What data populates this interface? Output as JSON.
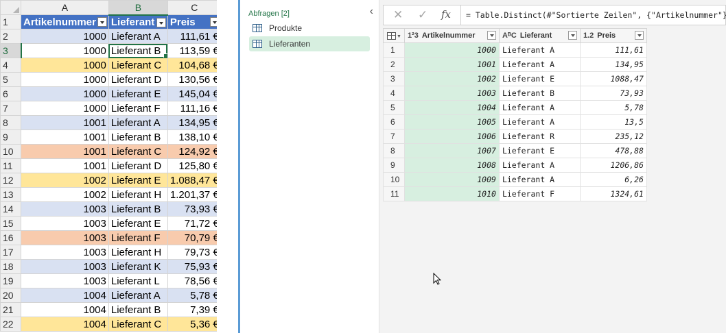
{
  "excel": {
    "col_headers": [
      "A",
      "B",
      "C"
    ],
    "table_headers": [
      "Artikelnummer",
      "Lieferant",
      "Preis"
    ],
    "rows": [
      {
        "rownum": "2",
        "art": "1000",
        "lief": "Lieferant A",
        "preis": "111,61 €",
        "color": "blue"
      },
      {
        "rownum": "3",
        "art": "1000",
        "lief": "Lieferant B",
        "preis": "113,59 €",
        "color": "white"
      },
      {
        "rownum": "4",
        "art": "1000",
        "lief": "Lieferant C",
        "preis": "104,68 €",
        "color": "yellow"
      },
      {
        "rownum": "5",
        "art": "1000",
        "lief": "Lieferant D",
        "preis": "130,56 €",
        "color": "white"
      },
      {
        "rownum": "6",
        "art": "1000",
        "lief": "Lieferant E",
        "preis": "145,04 €",
        "color": "blue"
      },
      {
        "rownum": "7",
        "art": "1000",
        "lief": "Lieferant F",
        "preis": "111,16 €",
        "color": "white"
      },
      {
        "rownum": "8",
        "art": "1001",
        "lief": "Lieferant A",
        "preis": "134,95 €",
        "color": "blue"
      },
      {
        "rownum": "9",
        "art": "1001",
        "lief": "Lieferant B",
        "preis": "138,10 €",
        "color": "white"
      },
      {
        "rownum": "10",
        "art": "1001",
        "lief": "Lieferant C",
        "preis": "124,92 €",
        "color": "orange"
      },
      {
        "rownum": "11",
        "art": "1001",
        "lief": "Lieferant D",
        "preis": "125,80 €",
        "color": "white"
      },
      {
        "rownum": "12",
        "art": "1002",
        "lief": "Lieferant E",
        "preis": "1.088,47 €",
        "color": "yellow"
      },
      {
        "rownum": "13",
        "art": "1002",
        "lief": "Lieferant H",
        "preis": "1.201,37 €",
        "color": "white"
      },
      {
        "rownum": "14",
        "art": "1003",
        "lief": "Lieferant B",
        "preis": "73,93 €",
        "color": "blue"
      },
      {
        "rownum": "15",
        "art": "1003",
        "lief": "Lieferant E",
        "preis": "71,72 €",
        "color": "white"
      },
      {
        "rownum": "16",
        "art": "1003",
        "lief": "Lieferant F",
        "preis": "70,79 €",
        "color": "orange"
      },
      {
        "rownum": "17",
        "art": "1003",
        "lief": "Lieferant H",
        "preis": "79,73 €",
        "color": "white"
      },
      {
        "rownum": "18",
        "art": "1003",
        "lief": "Lieferant K",
        "preis": "75,93 €",
        "color": "blue"
      },
      {
        "rownum": "19",
        "art": "1003",
        "lief": "Lieferant L",
        "preis": "78,56 €",
        "color": "white"
      },
      {
        "rownum": "20",
        "art": "1004",
        "lief": "Lieferant A",
        "preis": "5,78 €",
        "color": "blue"
      },
      {
        "rownum": "21",
        "art": "1004",
        "lief": "Lieferant B",
        "preis": "7,39 €",
        "color": "white"
      },
      {
        "rownum": "22",
        "art": "1004",
        "lief": "Lieferant C",
        "preis": "5,36 €",
        "color": "yellow"
      }
    ],
    "active_row": "3",
    "colors": {
      "header": "#4472c4",
      "blue": "#d9e1f2",
      "yellow": "#ffe699",
      "orange": "#f8cbad"
    }
  },
  "queries": {
    "header": "Abfragen [2]",
    "collapse_icon": "chevron-left-icon",
    "items": [
      {
        "label": "Produkte",
        "selected": false
      },
      {
        "label": "Lieferanten",
        "selected": true
      }
    ]
  },
  "editor": {
    "formula_cancel": "✕",
    "formula_confirm": "✓",
    "formula_fx": "fx",
    "formula": "= Table.Distinct(#\"Sortierte Zeilen\", {\"Artikelnummer\"})",
    "columns": [
      {
        "type_icon": "1²3",
        "label": "Artikelnummer"
      },
      {
        "type_icon": "AᴮC",
        "label": "Lieferant"
      },
      {
        "type_icon": "1.2",
        "label": "Preis"
      }
    ],
    "rows": [
      {
        "n": "1",
        "art": "1000",
        "lief": "Lieferant A",
        "preis": "111,61"
      },
      {
        "n": "2",
        "art": "1001",
        "lief": "Lieferant A",
        "preis": "134,95"
      },
      {
        "n": "3",
        "art": "1002",
        "lief": "Lieferant E",
        "preis": "1088,47"
      },
      {
        "n": "4",
        "art": "1003",
        "lief": "Lieferant B",
        "preis": "73,93"
      },
      {
        "n": "5",
        "art": "1004",
        "lief": "Lieferant A",
        "preis": "5,78"
      },
      {
        "n": "6",
        "art": "1005",
        "lief": "Lieferant A",
        "preis": "13,5"
      },
      {
        "n": "7",
        "art": "1006",
        "lief": "Lieferant R",
        "preis": "235,12"
      },
      {
        "n": "8",
        "art": "1007",
        "lief": "Lieferant E",
        "preis": "478,88"
      },
      {
        "n": "9",
        "art": "1008",
        "lief": "Lieferant A",
        "preis": "1206,86"
      },
      {
        "n": "10",
        "art": "1009",
        "lief": "Lieferant A",
        "preis": "6,26"
      },
      {
        "n": "11",
        "art": "1010",
        "lief": "Lieferant F",
        "preis": "1324,61"
      }
    ]
  }
}
